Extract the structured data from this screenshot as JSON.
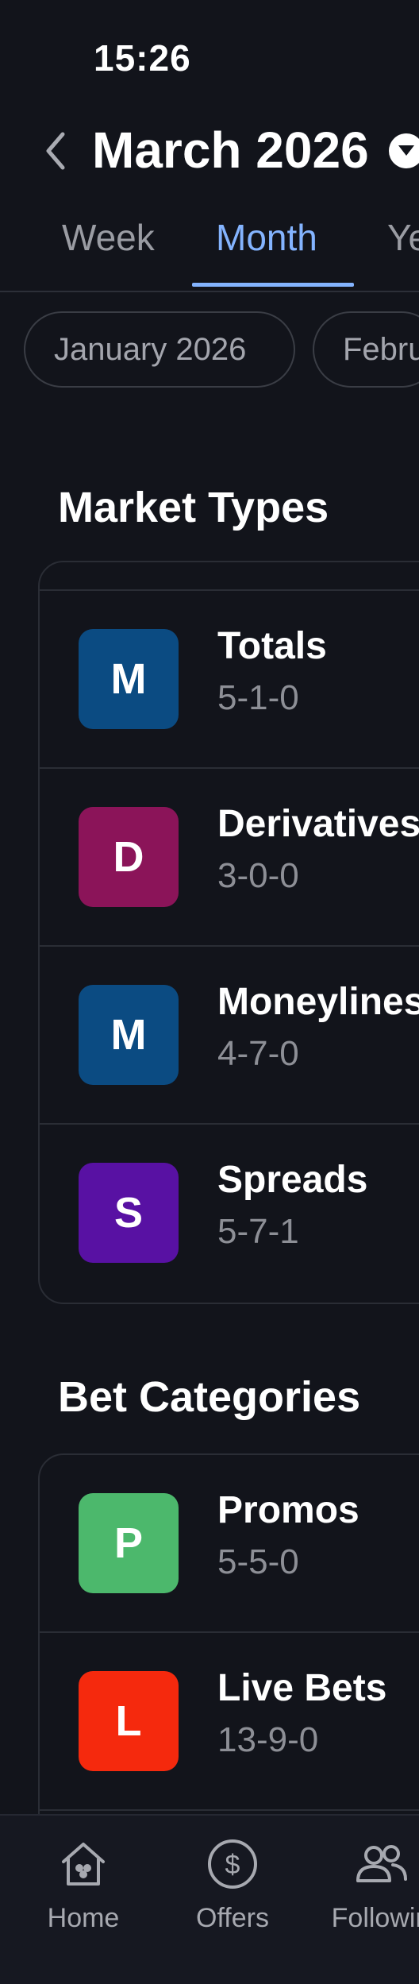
{
  "status_bar": {
    "time": "15:26"
  },
  "header": {
    "title": "March 2026"
  },
  "tabs": [
    {
      "label": "Week"
    },
    {
      "label": "Month"
    },
    {
      "label": "Ye"
    }
  ],
  "period_chips": [
    {
      "label": "January 2026"
    },
    {
      "label": "Febru"
    }
  ],
  "market_types": {
    "title": "Market Types",
    "items": [
      {
        "badge": "M",
        "name": "Totals",
        "record": "5-1-0",
        "color": "#0b4b82"
      },
      {
        "badge": "D",
        "name": "Derivatives",
        "record": "3-0-0",
        "color": "#8b1459"
      },
      {
        "badge": "M",
        "name": "Moneylines",
        "record": "4-7-0",
        "color": "#0b4b82"
      },
      {
        "badge": "S",
        "name": "Spreads",
        "record": "5-7-1",
        "color": "#5811a3"
      }
    ]
  },
  "bet_categories": {
    "title": "Bet Categories",
    "items": [
      {
        "badge": "P",
        "name": "Promos",
        "record": "5-5-0",
        "color": "#4cb86c"
      },
      {
        "badge": "L",
        "name": "Live Bets",
        "record": "13-9-0",
        "color": "#f5290d"
      }
    ]
  },
  "bottom_nav": {
    "items": [
      {
        "label": "Home",
        "icon": "home-icon"
      },
      {
        "label": "Offers",
        "icon": "dollar-icon"
      },
      {
        "label": "Followin",
        "icon": "people-icon"
      }
    ]
  },
  "colors": {
    "background": "#12141b",
    "accent": "#84b4ff",
    "muted_text": "#8d8f96"
  }
}
